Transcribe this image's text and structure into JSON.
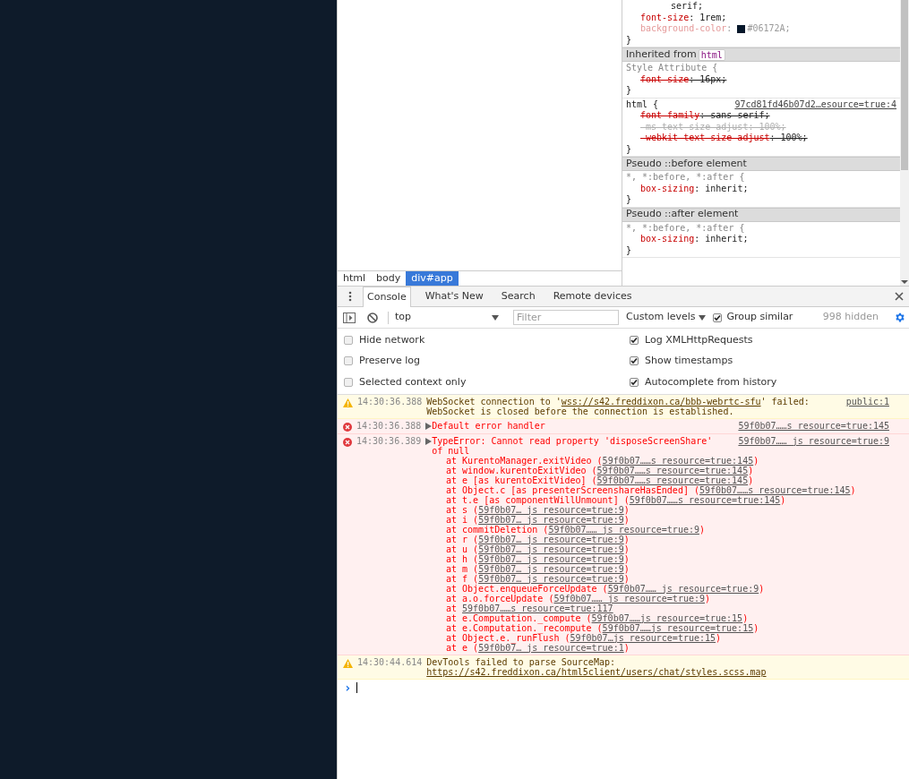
{
  "elements": {
    "breadcrumbs": [
      {
        "label": "html",
        "selected": false
      },
      {
        "label": "body",
        "selected": false
      },
      {
        "label": "div#app",
        "selected": true
      }
    ]
  },
  "styles": [
    {
      "kind": "rule",
      "props": [
        {
          "kind": "continuation",
          "value": "serif;"
        },
        {
          "kind": "prop",
          "name": "font-size",
          "value": ": 1rem;",
          "overridden": false,
          "inactive": false
        },
        {
          "kind": "prop",
          "name": "background-color",
          "value": ": #06172A;",
          "color": "#06172a",
          "overridden": false,
          "inactive": true
        }
      ],
      "close": "}"
    },
    {
      "kind": "header",
      "text": "Inherited from",
      "tag": "html"
    },
    {
      "kind": "rule",
      "selector": "Style Attribute {",
      "dim": true,
      "props": [
        {
          "kind": "prop",
          "name": "font-size",
          "value": ": 16px;",
          "overridden": true,
          "inactive": false
        }
      ],
      "close": "}"
    },
    {
      "kind": "rule",
      "selector": "html {",
      "dim": false,
      "source": "97cd81fd46b07d2…esource=true:4",
      "props": [
        {
          "kind": "prop",
          "name": "font-family",
          "value": ": sans-serif;",
          "overridden": true,
          "inactive": false
        },
        {
          "kind": "prop",
          "name": "-ms-text-size-adjust",
          "value": ": 100%;",
          "overridden": true,
          "inactive": true
        },
        {
          "kind": "prop",
          "name": "-webkit-text-size-adjust",
          "value": ": 100%;",
          "overridden": true,
          "inactive": false
        }
      ],
      "close": "}"
    },
    {
      "kind": "header",
      "text": "Pseudo ::before element"
    },
    {
      "kind": "rule",
      "selector": "*, *:before, *:after {",
      "dim": true,
      "props": [
        {
          "kind": "prop",
          "name": "box-sizing",
          "value": ": inherit;",
          "overridden": false,
          "inactive": false
        }
      ],
      "close": "}"
    },
    {
      "kind": "header",
      "text": "Pseudo ::after element"
    },
    {
      "kind": "rule",
      "selector": "*, *:before, *:after {",
      "dim": true,
      "props": [
        {
          "kind": "prop",
          "name": "box-sizing",
          "value": ": inherit;",
          "overridden": false,
          "inactive": false
        }
      ],
      "close": "}"
    }
  ],
  "drawer": {
    "tabs": [
      {
        "label": "Console",
        "selected": true
      },
      {
        "label": "What's New",
        "selected": false
      },
      {
        "label": "Search",
        "selected": false
      },
      {
        "label": "Remote devices",
        "selected": false
      }
    ]
  },
  "toolbar": {
    "context": "top",
    "filter": {
      "placeholder": "Filter"
    },
    "levels": "Custom levels",
    "group_similar": {
      "label": "Group similar",
      "checked": true
    },
    "hidden_count": "998 hidden"
  },
  "settings": [
    {
      "label": "Hide network",
      "checked": false
    },
    {
      "label": "Log XMLHttpRequests",
      "checked": true
    },
    {
      "label": "Preserve log",
      "checked": false
    },
    {
      "label": "Show timestamps",
      "checked": true
    },
    {
      "label": "Selected context only",
      "checked": false
    },
    {
      "label": "Autocomplete from history",
      "checked": true
    }
  ],
  "messages": [
    {
      "kind": "warning",
      "time": "14:30:36.388",
      "parts": [
        {
          "text": "WebSocket connection to '"
        },
        {
          "link": "wss://s42.freddixon.ca/bbb-webrtc-sfu"
        },
        {
          "text": "' failed: WebSocket is closed before the connection is established."
        }
      ],
      "source": "public:1"
    },
    {
      "kind": "error",
      "time": "14:30:36.388",
      "expanded": false,
      "parts": [
        {
          "text": "Default error handler"
        }
      ],
      "source": "59f0b07……s resource=true:145"
    },
    {
      "kind": "error",
      "time": "14:30:36.389",
      "expanded": false,
      "parts": [
        {
          "text": "TypeError: Cannot read property 'disposeScreenShare' of null"
        }
      ],
      "source": "59f0b07…… js resource=true:9",
      "trace": [
        {
          "pre": "at KurentoManager.exitVideo (",
          "link": "59f0b07……s resource=true:145",
          "post": ")"
        },
        {
          "pre": "at window.kurentoExitVideo (",
          "link": "59f0b07……s resource=true:145",
          "post": ")"
        },
        {
          "pre": "at e [as kurentoExitVideo] (",
          "link": "59f0b07……s resource=true:145",
          "post": ")"
        },
        {
          "pre": "at Object.c [as presenterScreenshareHasEnded] (",
          "link": "59f0b07……s resource=true:145",
          "post": ")"
        },
        {
          "pre": "at t.e [as componentWillUnmount] (",
          "link": "59f0b07……s resource=true:145",
          "post": ")"
        },
        {
          "pre": "at s (",
          "link": "59f0b07… js resource=true:9",
          "post": ")"
        },
        {
          "pre": "at i (",
          "link": "59f0b07… js resource=true:9",
          "post": ")"
        },
        {
          "pre": "at commitDeletion (",
          "link": "59f0b07…… js resource=true:9",
          "post": ")"
        },
        {
          "pre": "at r (",
          "link": "59f0b07… js resource=true:9",
          "post": ")"
        },
        {
          "pre": "at u (",
          "link": "59f0b07… js resource=true:9",
          "post": ")"
        },
        {
          "pre": "at h (",
          "link": "59f0b07… js resource=true:9",
          "post": ")"
        },
        {
          "pre": "at m (",
          "link": "59f0b07… js resource=true:9",
          "post": ")"
        },
        {
          "pre": "at f (",
          "link": "59f0b07… js resource=true:9",
          "post": ")"
        },
        {
          "pre": "at Object.enqueueForceUpdate (",
          "link": "59f0b07…… js resource=true:9",
          "post": ")"
        },
        {
          "pre": "at a.o.forceUpdate (",
          "link": "59f0b07…… js resource=true:9",
          "post": ")"
        },
        {
          "pre": "at ",
          "link": "59f0b07……s resource=true:117"
        },
        {
          "pre": "at e.Computation._compute (",
          "link": "59f0b07……js resource=true:15",
          "post": ")"
        },
        {
          "pre": "at e.Computation._recompute (",
          "link": "59f0b07……js resource=true:15",
          "post": ")"
        },
        {
          "pre": "at Object.e._runFlush (",
          "link": "59f0b07…js resource=true:15",
          "post": ")"
        },
        {
          "pre": "at e (",
          "link": "59f0b07… js resource=true:1",
          "post": ")"
        }
      ]
    },
    {
      "kind": "warning",
      "time": "14:30:44.614",
      "parts": [
        {
          "text": "DevTools failed to parse SourceMap: "
        },
        {
          "link": "https://s42.freddixon.ca/html5client/users/chat/styles.scss.map"
        }
      ]
    }
  ],
  "prompt": {
    "symbol": "›"
  }
}
